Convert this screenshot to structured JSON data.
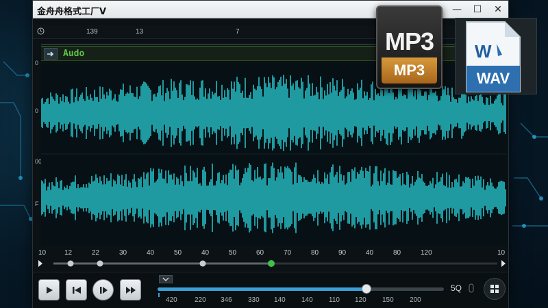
{
  "window": {
    "title": "金舟舟格式工厂V",
    "controls": [
      "—",
      "☐",
      "✕"
    ]
  },
  "top_ruler": [
    "139",
    "13",
    "7"
  ],
  "track": {
    "clip_name": "Audo",
    "side_labels": [
      "0",
      "0",
      "00",
      "F"
    ]
  },
  "bottom_ruler": [
    "10",
    "12",
    "22",
    "30",
    "40",
    "50",
    "40",
    "50",
    "60",
    "70",
    "80",
    "90",
    "40",
    "80",
    "120",
    "10"
  ],
  "transport": {
    "volume_label": "5Q",
    "volume_level": 0.73,
    "scale": [
      "420",
      "220",
      "346",
      "330",
      "140",
      "140",
      "110",
      "120",
      "120",
      "150",
      "200"
    ]
  },
  "badges": {
    "mp3_big": "MP3",
    "mp3_small": "MP3",
    "wav_letter": "W",
    "wav_label": "WAV"
  },
  "colors": {
    "waveform": "#1f9aa1",
    "accent": "#3aa0d8",
    "clip_name": "#5fc24a",
    "mp3_band": "#c07e2a"
  }
}
